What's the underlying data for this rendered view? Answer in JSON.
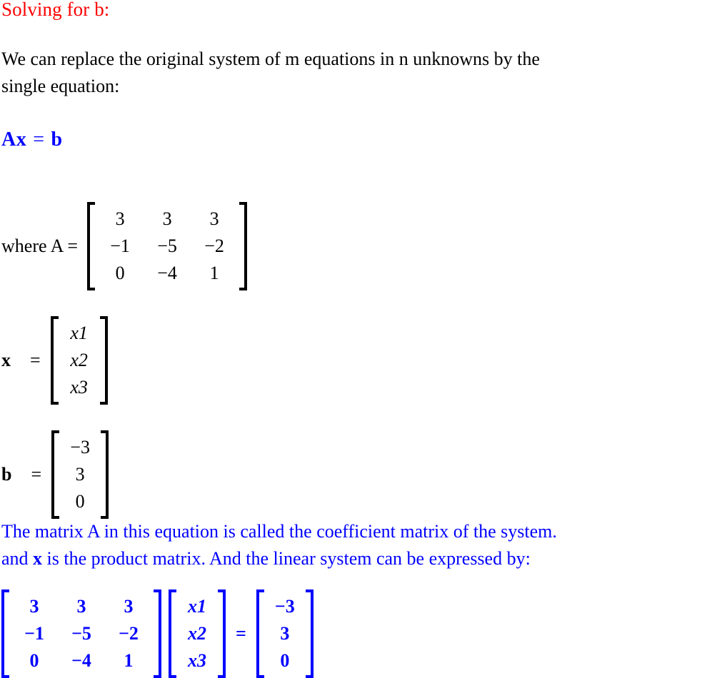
{
  "document": {
    "title": "Solving for b:",
    "title_color": "#ff0000",
    "accent_color": "#0000ff",
    "text_color": "#000000"
  },
  "paragraphs": {
    "intro_line1": "We can replace the original system of m equations in n unknowns by the",
    "intro_line2": "single equation:",
    "coeff_line1": "The matrix A in this equation is called the coefficient matrix of the system.",
    "coeff_line2_a": "and ",
    "coeff_line2_b": "x",
    "coeff_line2_c": " is the product matrix. And the linear system can be expressed by:"
  },
  "equations": {
    "axb": {
      "matrix_symbol": "A",
      "unknown_symbol": "x",
      "operator": "=",
      "rhs_symbol": "b"
    },
    "matrix_a": {
      "label": "where A =",
      "rows": [
        [
          "3",
          "3",
          "3"
        ],
        [
          "−1",
          "−5",
          "−2"
        ],
        [
          "0",
          "−4",
          "1"
        ]
      ]
    },
    "vector_x": {
      "label": "x",
      "operator": "=",
      "rows": [
        [
          "x1"
        ],
        [
          "x2"
        ],
        [
          "x3"
        ]
      ]
    },
    "vector_b": {
      "label": "b",
      "operator": "=",
      "rows": [
        [
          "−3"
        ],
        [
          "3"
        ],
        [
          "0"
        ]
      ]
    },
    "system": {
      "coefficient_rows": [
        [
          "3",
          "3",
          "3"
        ],
        [
          "−1",
          "−5",
          "−2"
        ],
        [
          "0",
          "−4",
          "1"
        ]
      ],
      "unknown_rows": [
        [
          "x1"
        ],
        [
          "x2"
        ],
        [
          "x3"
        ]
      ],
      "operator": "=",
      "constant_rows": [
        [
          "−3"
        ],
        [
          "3"
        ],
        [
          "0"
        ]
      ]
    }
  }
}
